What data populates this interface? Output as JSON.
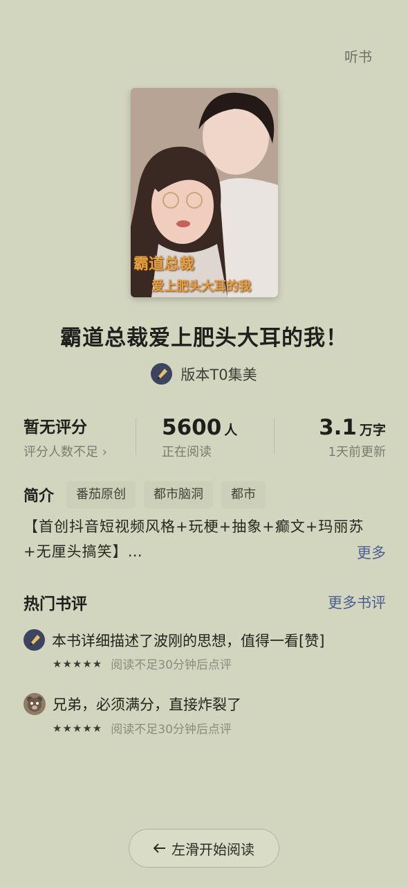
{
  "header": {
    "listen_label": "听书"
  },
  "cover": {
    "title_text": "霸道总裁",
    "subtitle_text": "爱上肥头大耳的我"
  },
  "book": {
    "title": "霸道总裁爱上肥头大耳的我！",
    "author": "版本T0集美"
  },
  "stats": {
    "rating_value": "暂无评分",
    "rating_sub": "评分人数不足 ›",
    "readers_num": "5600",
    "readers_unit": "人",
    "readers_sub": "正在阅读",
    "words_num": "3.1",
    "words_unit": "万字",
    "words_sub": "1天前更新"
  },
  "intro": {
    "label": "简介",
    "tags": [
      "番茄原创",
      "都市脑洞",
      "都市"
    ],
    "text": "【首创抖音短视频风格+玩梗+抽象+癫文+玛丽苏+无厘头搞笑】…",
    "more_label": "更多"
  },
  "reviews": {
    "title": "热门书评",
    "more_label": "更多书评",
    "items": [
      {
        "avatar_icon": "pen-avatar-icon",
        "text": "本书详细描述了波刚的思想，值得一看[赞]",
        "stars": "★★★★★",
        "hint": "阅读不足30分钟后点评"
      },
      {
        "avatar_icon": "bear-avatar-icon",
        "text": "兄弟，必须满分，直接炸裂了",
        "stars": "★★★★★",
        "hint": "阅读不足30分钟后点评"
      }
    ]
  },
  "footer": {
    "read_button_label": "左滑开始阅读",
    "arrow_icon": "arrow-left-icon"
  }
}
